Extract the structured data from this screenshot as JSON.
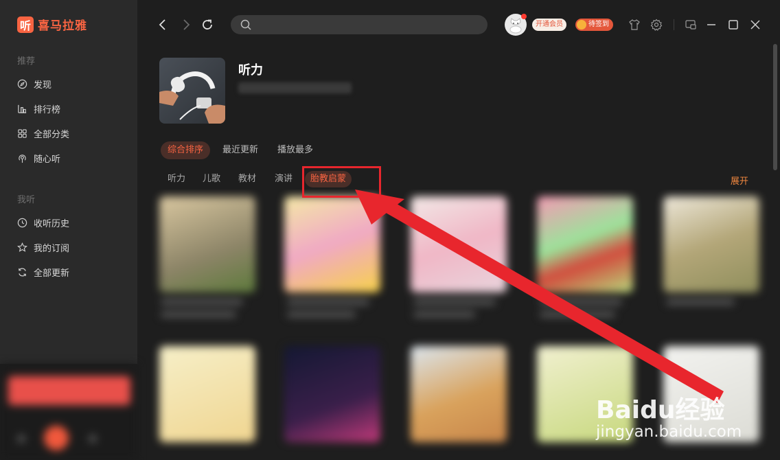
{
  "app": {
    "logo_glyph": "听",
    "logo_text": "喜马拉雅",
    "brand_color": "#f86442"
  },
  "sidebar": {
    "section_recommend": "推荐",
    "recommend_items": [
      {
        "label": "发现",
        "icon": "compass-icon"
      },
      {
        "label": "排行榜",
        "icon": "chart-icon"
      },
      {
        "label": "全部分类",
        "icon": "grid-icon"
      },
      {
        "label": "随心听",
        "icon": "radio-icon"
      }
    ],
    "section_mine": "我听",
    "mine_items": [
      {
        "label": "收听历史",
        "icon": "clock-icon"
      },
      {
        "label": "我的订阅",
        "icon": "star-icon"
      },
      {
        "label": "全部更新",
        "icon": "refresh-icon"
      }
    ]
  },
  "topbar": {
    "search_placeholder": "",
    "vip_label": "开通会员",
    "sign_label": "待签到"
  },
  "category": {
    "title": "听力",
    "sort_tabs": [
      "综合排序",
      "最近更新",
      "播放最多"
    ],
    "active_sort": "综合排序",
    "sub_tabs": [
      "听力",
      "儿歌",
      "教材",
      "演讲",
      "胎教启蒙"
    ],
    "active_sub": "胎教启蒙",
    "expand_label": "展开"
  },
  "annotation": {
    "highlight_color": "#e8262d"
  },
  "watermark": {
    "main": "Baidu经验",
    "sub": "jingyan.baidu.com"
  }
}
